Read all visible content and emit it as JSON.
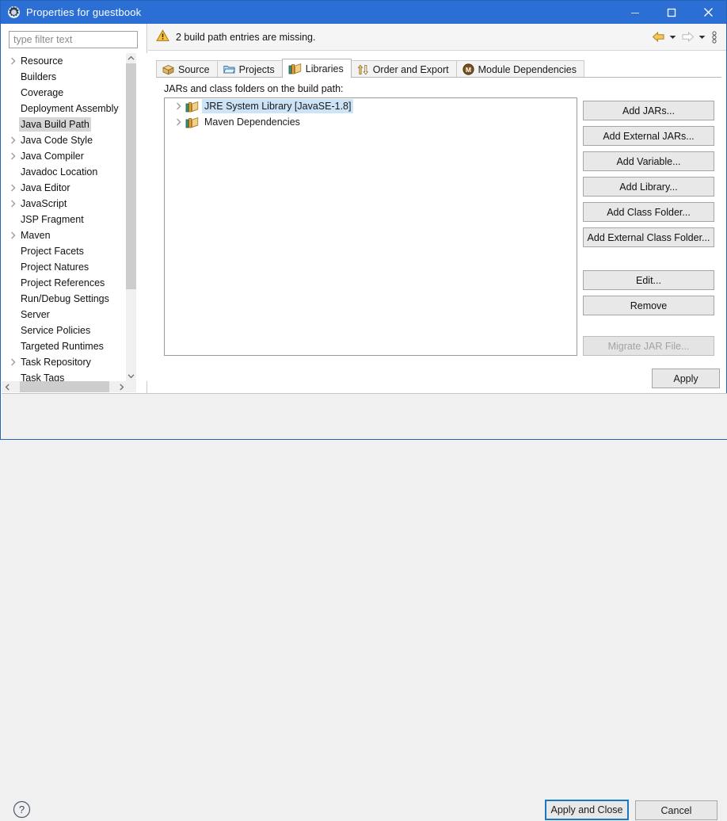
{
  "window": {
    "title": "Properties for guestbook",
    "icon": "gear-icon",
    "minimize_label": "Minimize",
    "maximize_label": "Maximize",
    "close_label": "Close",
    "titlebar_color": "#2b6fd4"
  },
  "filter": {
    "placeholder": "type filter text",
    "value": ""
  },
  "sidebar": {
    "items": [
      {
        "label": "Resource",
        "expandable": true,
        "selected": false
      },
      {
        "label": "Builders",
        "expandable": false,
        "selected": false
      },
      {
        "label": "Coverage",
        "expandable": false,
        "selected": false
      },
      {
        "label": "Deployment Assembly",
        "expandable": false,
        "selected": false
      },
      {
        "label": "Java Build Path",
        "expandable": false,
        "selected": true
      },
      {
        "label": "Java Code Style",
        "expandable": true,
        "selected": false
      },
      {
        "label": "Java Compiler",
        "expandable": true,
        "selected": false
      },
      {
        "label": "Javadoc Location",
        "expandable": false,
        "selected": false
      },
      {
        "label": "Java Editor",
        "expandable": true,
        "selected": false
      },
      {
        "label": "JavaScript",
        "expandable": true,
        "selected": false
      },
      {
        "label": "JSP Fragment",
        "expandable": false,
        "selected": false
      },
      {
        "label": "Maven",
        "expandable": true,
        "selected": false
      },
      {
        "label": "Project Facets",
        "expandable": false,
        "selected": false
      },
      {
        "label": "Project Natures",
        "expandable": false,
        "selected": false
      },
      {
        "label": "Project References",
        "expandable": false,
        "selected": false
      },
      {
        "label": "Run/Debug Settings",
        "expandable": false,
        "selected": false
      },
      {
        "label": "Server",
        "expandable": false,
        "selected": false
      },
      {
        "label": "Service Policies",
        "expandable": false,
        "selected": false
      },
      {
        "label": "Targeted Runtimes",
        "expandable": false,
        "selected": false
      },
      {
        "label": "Task Repository",
        "expandable": true,
        "selected": false
      },
      {
        "label": "Task Tags",
        "expandable": false,
        "selected": false
      }
    ]
  },
  "message": {
    "icon": "warning-icon",
    "text": "2 build path entries are missing."
  },
  "navigation": {
    "back_label": "Back",
    "back_menu_label": "Back history",
    "forward_label": "Forward",
    "forward_menu_label": "Forward history",
    "menu_label": "View Menu"
  },
  "tabs": [
    {
      "label": "Source",
      "icon": "package-icon",
      "active": false
    },
    {
      "label": "Projects",
      "icon": "folder-icon",
      "active": false
    },
    {
      "label": "Libraries",
      "icon": "library-books-icon",
      "active": true
    },
    {
      "label": "Order and Export",
      "icon": "order-arrows-icon",
      "active": false
    },
    {
      "label": "Module Dependencies",
      "icon": "module-icon",
      "active": false
    }
  ],
  "main": {
    "list_label": "JARs and class folders on the build path:",
    "entries": [
      {
        "label": "JRE System Library [JavaSE-1.8]",
        "icon": "library-books-icon",
        "selected": true,
        "expandable": true
      },
      {
        "label": "Maven Dependencies",
        "icon": "library-books-icon",
        "selected": false,
        "expandable": true
      }
    ]
  },
  "side_buttons": [
    {
      "label": "Add JARs...",
      "enabled": true
    },
    {
      "label": "Add External JARs...",
      "enabled": true
    },
    {
      "label": "Add Variable...",
      "enabled": true
    },
    {
      "label": "Add Library...",
      "enabled": true
    },
    {
      "label": "Add Class Folder...",
      "enabled": true
    },
    {
      "label": "Add External Class Folder...",
      "enabled": true
    },
    {
      "label": "Edit...",
      "enabled": true
    },
    {
      "label": "Remove",
      "enabled": true
    },
    {
      "label": "Migrate JAR File...",
      "enabled": false
    }
  ],
  "footer": {
    "apply_label": "Apply",
    "apply_and_close_label": "Apply and Close",
    "cancel_label": "Cancel",
    "help_label": "Help",
    "focus_color": "#1878c8"
  }
}
